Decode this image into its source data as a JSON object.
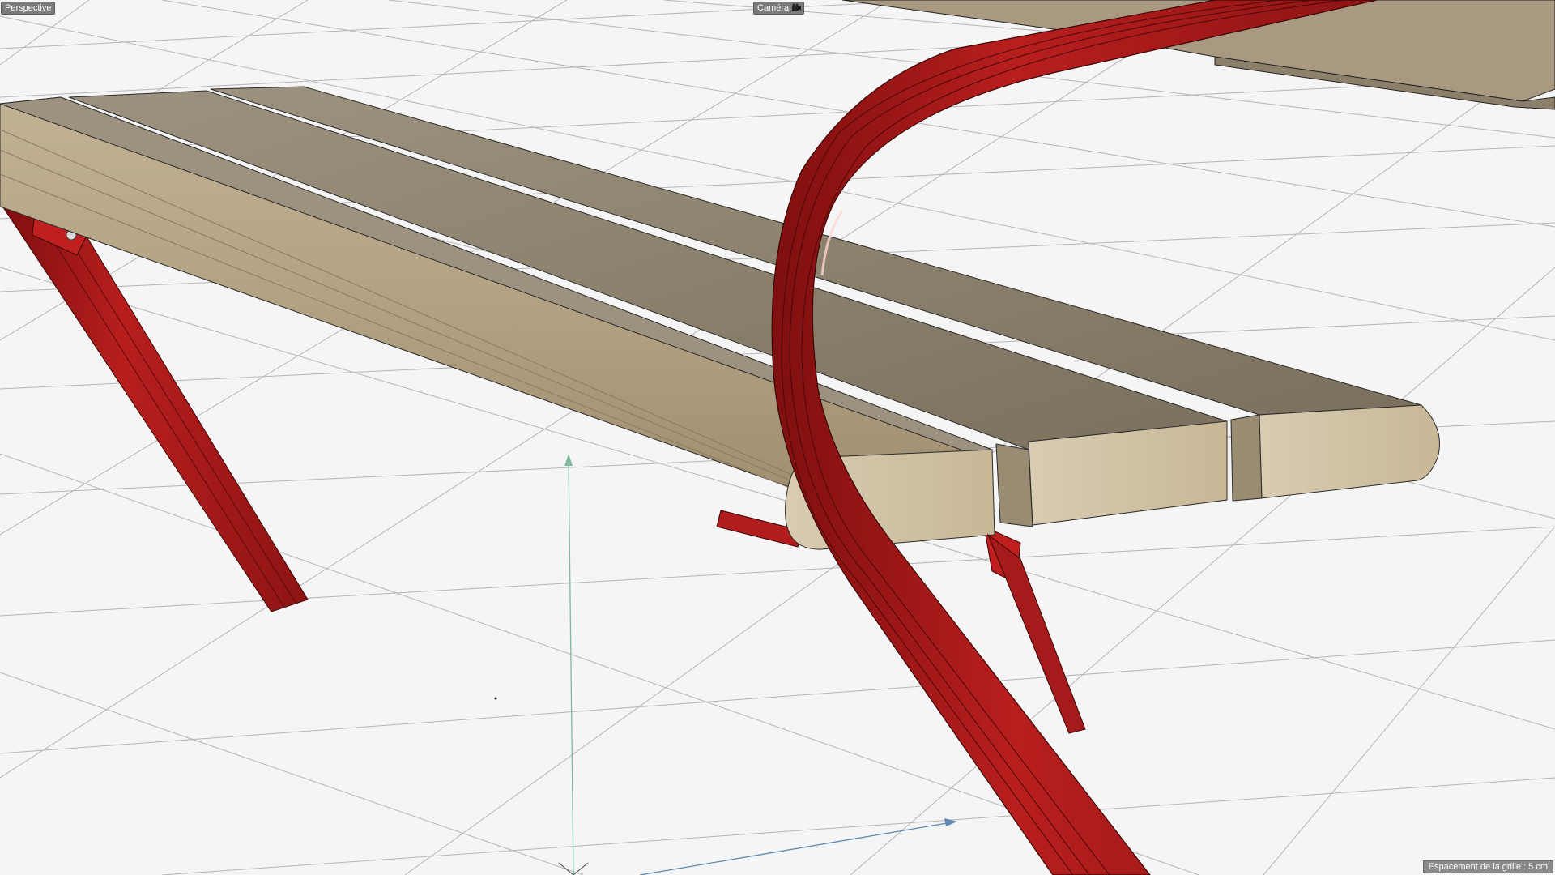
{
  "viewport": {
    "view_mode": "Perspective",
    "camera": "Caméra",
    "camera_icon": "camera-icon"
  },
  "status": {
    "grid_spacing": "Espacement de la grille : 5 cm"
  },
  "colors": {
    "background": "#f5f5f5",
    "grid_line": "#b5b5b5",
    "wood_light": "#c9b99c",
    "wood_dark": "#8f8470",
    "frame_red": "#b31c1c",
    "axis_green": "#7fb89a",
    "axis_blue": "#5f88b0"
  }
}
